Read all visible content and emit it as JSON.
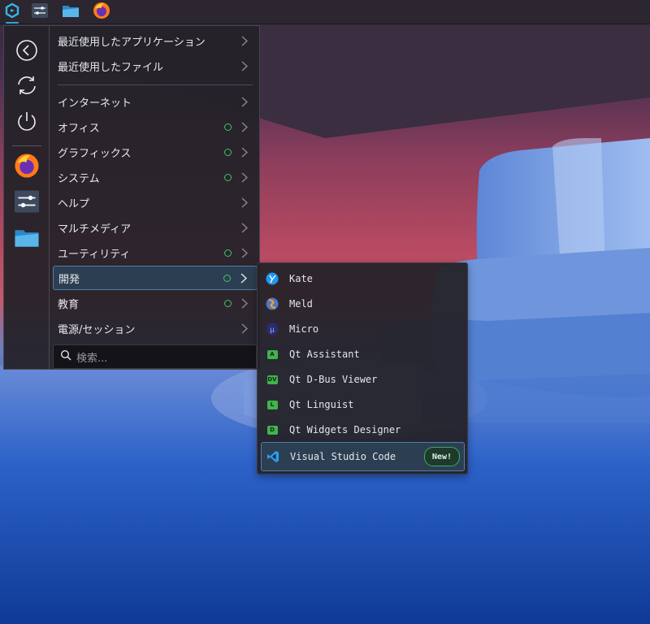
{
  "taskbar": {
    "items": [
      {
        "icon": "app-launcher-icon",
        "active": true
      },
      {
        "icon": "settings-sliders-icon"
      },
      {
        "icon": "file-manager-icon"
      },
      {
        "icon": "firefox-icon"
      }
    ]
  },
  "favorites": {
    "items": [
      {
        "icon": "back-arrow-icon"
      },
      {
        "icon": "refresh-icon"
      },
      {
        "icon": "power-icon"
      },
      {
        "icon": "firefox-icon"
      },
      {
        "icon": "settings-sliders-icon"
      },
      {
        "icon": "file-manager-icon"
      }
    ]
  },
  "menu": {
    "categories": [
      {
        "label": "最近使用したアプリケーション",
        "new": false
      },
      {
        "label": "最近使用したファイル",
        "new": false
      },
      {
        "label": "インターネット",
        "new": false
      },
      {
        "label": "オフィス",
        "new": true
      },
      {
        "label": "グラフィックス",
        "new": true
      },
      {
        "label": "システム",
        "new": true
      },
      {
        "label": "ヘルプ",
        "new": false
      },
      {
        "label": "マルチメディア",
        "new": false
      },
      {
        "label": "ユーティリティ",
        "new": true
      },
      {
        "label": "開発",
        "new": true,
        "selected": true
      },
      {
        "label": "教育",
        "new": true
      },
      {
        "label": "電源/セッション",
        "new": false
      }
    ],
    "search_placeholder": "検索..."
  },
  "submenu": {
    "apps": [
      {
        "label": "Kate",
        "icon": "kate-icon"
      },
      {
        "label": "Meld",
        "icon": "meld-icon"
      },
      {
        "label": "Micro",
        "icon": "micro-icon"
      },
      {
        "label": "Qt Assistant",
        "icon": "qt-assistant-icon",
        "glyph": "A"
      },
      {
        "label": "Qt D-Bus Viewer",
        "icon": "qt-dbus-viewer-icon",
        "glyph": "DV"
      },
      {
        "label": "Qt Linguist",
        "icon": "qt-linguist-icon",
        "glyph": "L"
      },
      {
        "label": "Qt Widgets Designer",
        "icon": "qt-designer-icon",
        "glyph": "D"
      },
      {
        "label": "Visual Studio Code",
        "icon": "vscode-icon",
        "badge": "New!"
      }
    ]
  },
  "colors": {
    "accent": "#29a8d8",
    "highlight_bg": "#2c3f52",
    "highlight_border": "#4d7fa6",
    "new_dot": "#3ec36b"
  }
}
